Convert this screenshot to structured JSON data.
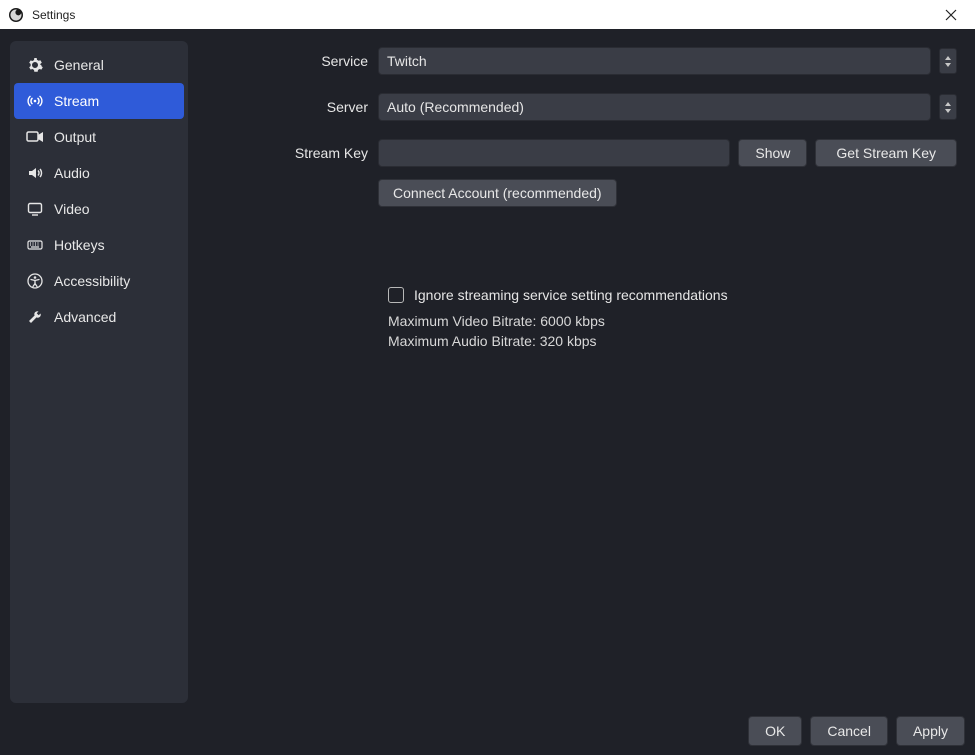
{
  "window": {
    "title": "Settings"
  },
  "sidebar": {
    "items": [
      {
        "label": "General"
      },
      {
        "label": "Stream"
      },
      {
        "label": "Output"
      },
      {
        "label": "Audio"
      },
      {
        "label": "Video"
      },
      {
        "label": "Hotkeys"
      },
      {
        "label": "Accessibility"
      },
      {
        "label": "Advanced"
      }
    ]
  },
  "form": {
    "service_label": "Service",
    "service_value": "Twitch",
    "server_label": "Server",
    "server_value": "Auto (Recommended)",
    "streamkey_label": "Stream Key",
    "streamkey_value": "",
    "show_btn": "Show",
    "getkey_btn": "Get Stream Key",
    "connect_btn": "Connect Account (recommended)",
    "ignore_label": "Ignore streaming service setting recommendations",
    "max_video": "Maximum Video Bitrate: 6000 kbps",
    "max_audio": "Maximum Audio Bitrate: 320 kbps"
  },
  "footer": {
    "ok": "OK",
    "cancel": "Cancel",
    "apply": "Apply"
  }
}
